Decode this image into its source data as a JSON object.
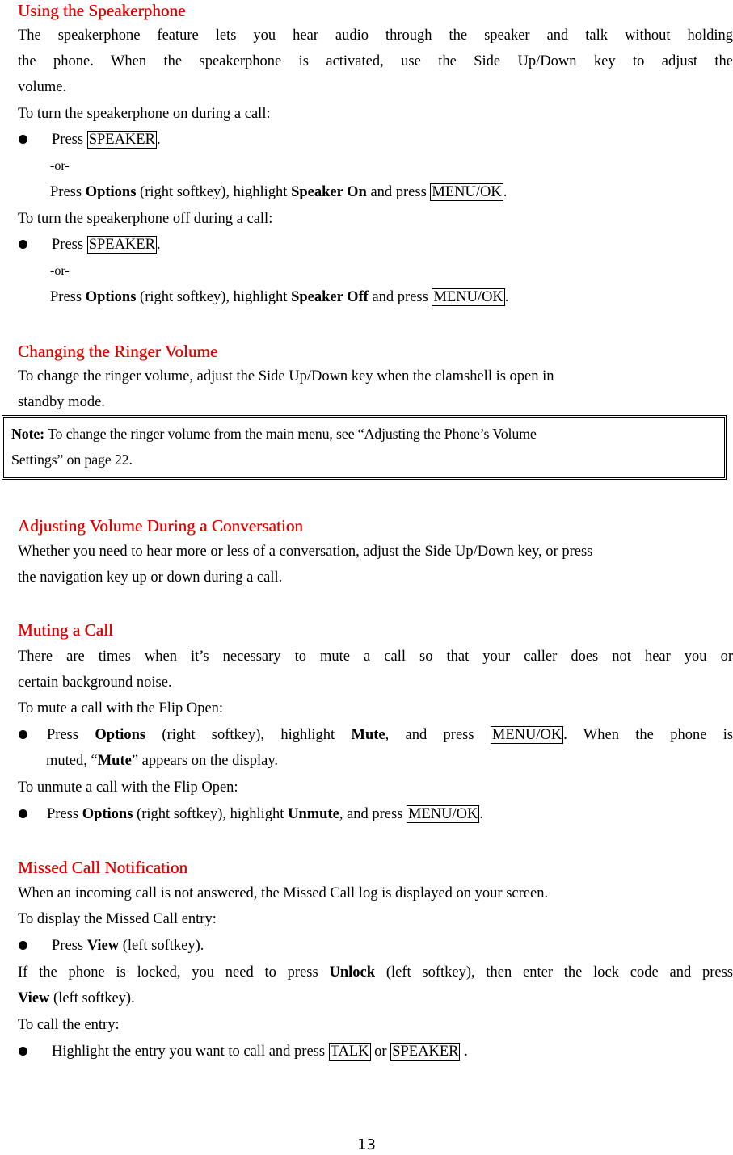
{
  "sections": {
    "speakerphone": {
      "heading": "Using the Speakerphone",
      "intro_line1": "The speakerphone feature lets you hear audio through the speaker and talk without holding",
      "intro_line2": "the phone. When the speakerphone is activated, use the Side Up/Down key to adjust the",
      "intro_line3": "volume.",
      "on_label": "To turn the speakerphone on during a call:",
      "off_label": "To turn the speakerphone off during a call:",
      "press": "Press",
      "speaker_key": "SPEAKER",
      "period": ".",
      "or": "-or-",
      "options": "Options",
      "right_softkey_highlight": "(right softkey), highlight",
      "speaker_on": "Speaker On",
      "speaker_off": "Speaker Off",
      "and_press": "and press",
      "menu_ok_key": "MENU/OK"
    },
    "ringer": {
      "heading": "Changing the Ringer Volume",
      "line1": "To change the ringer volume, adjust the Side Up/Down key when the clamshell is open in",
      "line2": "standby mode."
    },
    "note": {
      "label": "Note:",
      "line1": "To change the ringer volume from the main menu, see “Adjusting the Phone’s Volume",
      "line2": "Settings” on page 22."
    },
    "conversation": {
      "heading": "Adjusting Volume During a Conversation",
      "line1": "Whether you need to hear more or less of a conversation, adjust the Side Up/Down key, or press",
      "line2": "the navigation key up or down during a call."
    },
    "muting": {
      "heading": "Muting a Call",
      "line1": "There are times when it’s necessary to mute a call so that your caller does not hear you or",
      "line2": "certain background noise.",
      "mute_label": "To mute a call with the Flip Open:",
      "press": "Press",
      "options": "Options",
      "right_softkey_highlight": "(right softkey), highlight",
      "mute": "Mute",
      "and_press": ", and press",
      "menu_ok_key": "MENU/OK",
      "after_mute": ". When the phone is",
      "muted_pre": "muted, “",
      "muted_post": "” appears on the display.",
      "unmute_label": "To unmute a call with the Flip Open:",
      "unmute": "Unmute",
      "period": "."
    },
    "missed": {
      "heading": "Missed Call Notification",
      "line1": "When an incoming call is not answered, the Missed Call log is displayed on your screen.",
      "display_label": "To display the Missed Call entry:",
      "press": "Press",
      "view": "View",
      "left_softkey": "(left softkey).",
      "locked_pre": "If the phone is locked, you need to press",
      "unlock": "Unlock",
      "locked_post": "(left softkey), then enter the lock code and press",
      "call_label": "To call the entry:",
      "highlight_text": "Highlight the entry you want to call and press",
      "talk_key": "TALK",
      "or": "or",
      "speaker_key": "SPEAKER",
      "end": " ."
    }
  },
  "footer": {
    "page_number": "13"
  }
}
